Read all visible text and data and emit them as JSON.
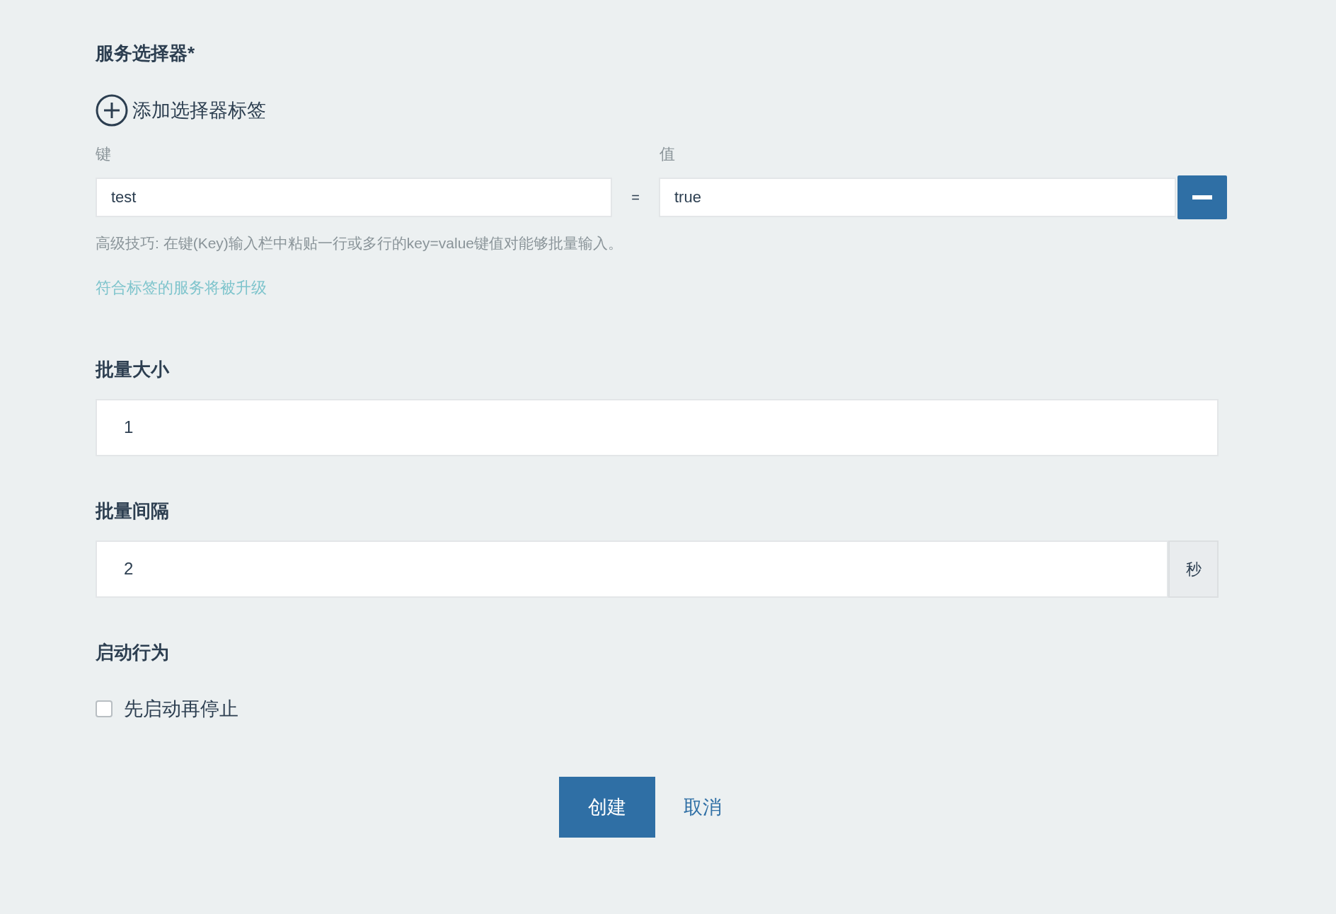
{
  "selector": {
    "title": "服务选择器*",
    "add_label": "添加选择器标签",
    "key_label": "键",
    "value_label": "值",
    "pairs": [
      {
        "key": "test",
        "equals": "=",
        "value": "true"
      }
    ],
    "hint": "高级技巧: 在键(Key)输入栏中粘贴一行或多行的key=value键值对能够批量输入。",
    "link": "符合标签的服务将被升级"
  },
  "batch_size": {
    "title": "批量大小",
    "value": "1"
  },
  "batch_interval": {
    "title": "批量间隔",
    "value": "2",
    "unit": "秒"
  },
  "start_behavior": {
    "title": "启动行为",
    "option": {
      "label": "先启动再停止",
      "checked": false
    }
  },
  "buttons": [
    {
      "label": "创建",
      "kind": "primary"
    },
    {
      "label": "取消",
      "kind": "link"
    }
  ]
}
